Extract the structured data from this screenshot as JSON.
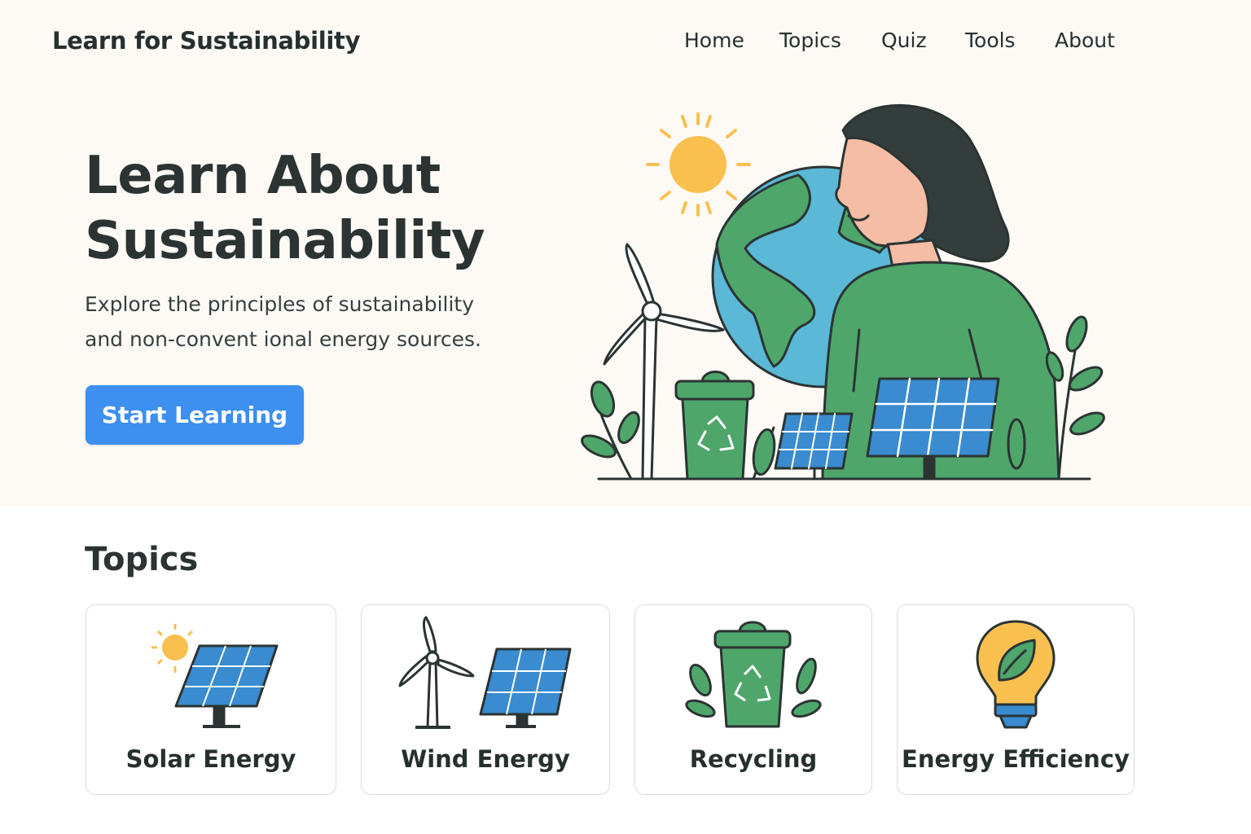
{
  "header": {
    "brand": "Learn for Sustainability",
    "nav": [
      "Home",
      "Topics",
      "Quiz",
      "Tools",
      "About"
    ]
  },
  "hero": {
    "title_line1": "Learn About",
    "title_line2": "Sustainability",
    "subtitle_line1": "Explore the principles of sustainability",
    "subtitle_line2": "and non-convent ional energy sources.",
    "cta_label": "Start Learning",
    "illustration_icons": [
      "sun-icon",
      "globe-icon",
      "wind-turbine-icon",
      "recycle-bin-icon",
      "solar-panel-icon",
      "person-illustration",
      "plant-icon"
    ]
  },
  "topics": {
    "heading": "Topics",
    "cards": [
      {
        "label": "Solar Energy",
        "icon": "solar-panel-icon"
      },
      {
        "label": "Wind Energy",
        "icon": "wind-turbine-icon"
      },
      {
        "label": "Recycling",
        "icon": "recycle-bin-icon"
      },
      {
        "label": "Energy Efficiency",
        "icon": "lightbulb-leaf-icon"
      }
    ]
  },
  "colors": {
    "background": "#fdfaf6",
    "accent_blue": "#3d8ff0",
    "green": "#4fa66b",
    "panel_blue": "#3a8bcf",
    "sun_yellow": "#f9c04f",
    "ocean": "#5bb8d6",
    "skin": "#f5bda5",
    "outline": "#2b3433"
  }
}
